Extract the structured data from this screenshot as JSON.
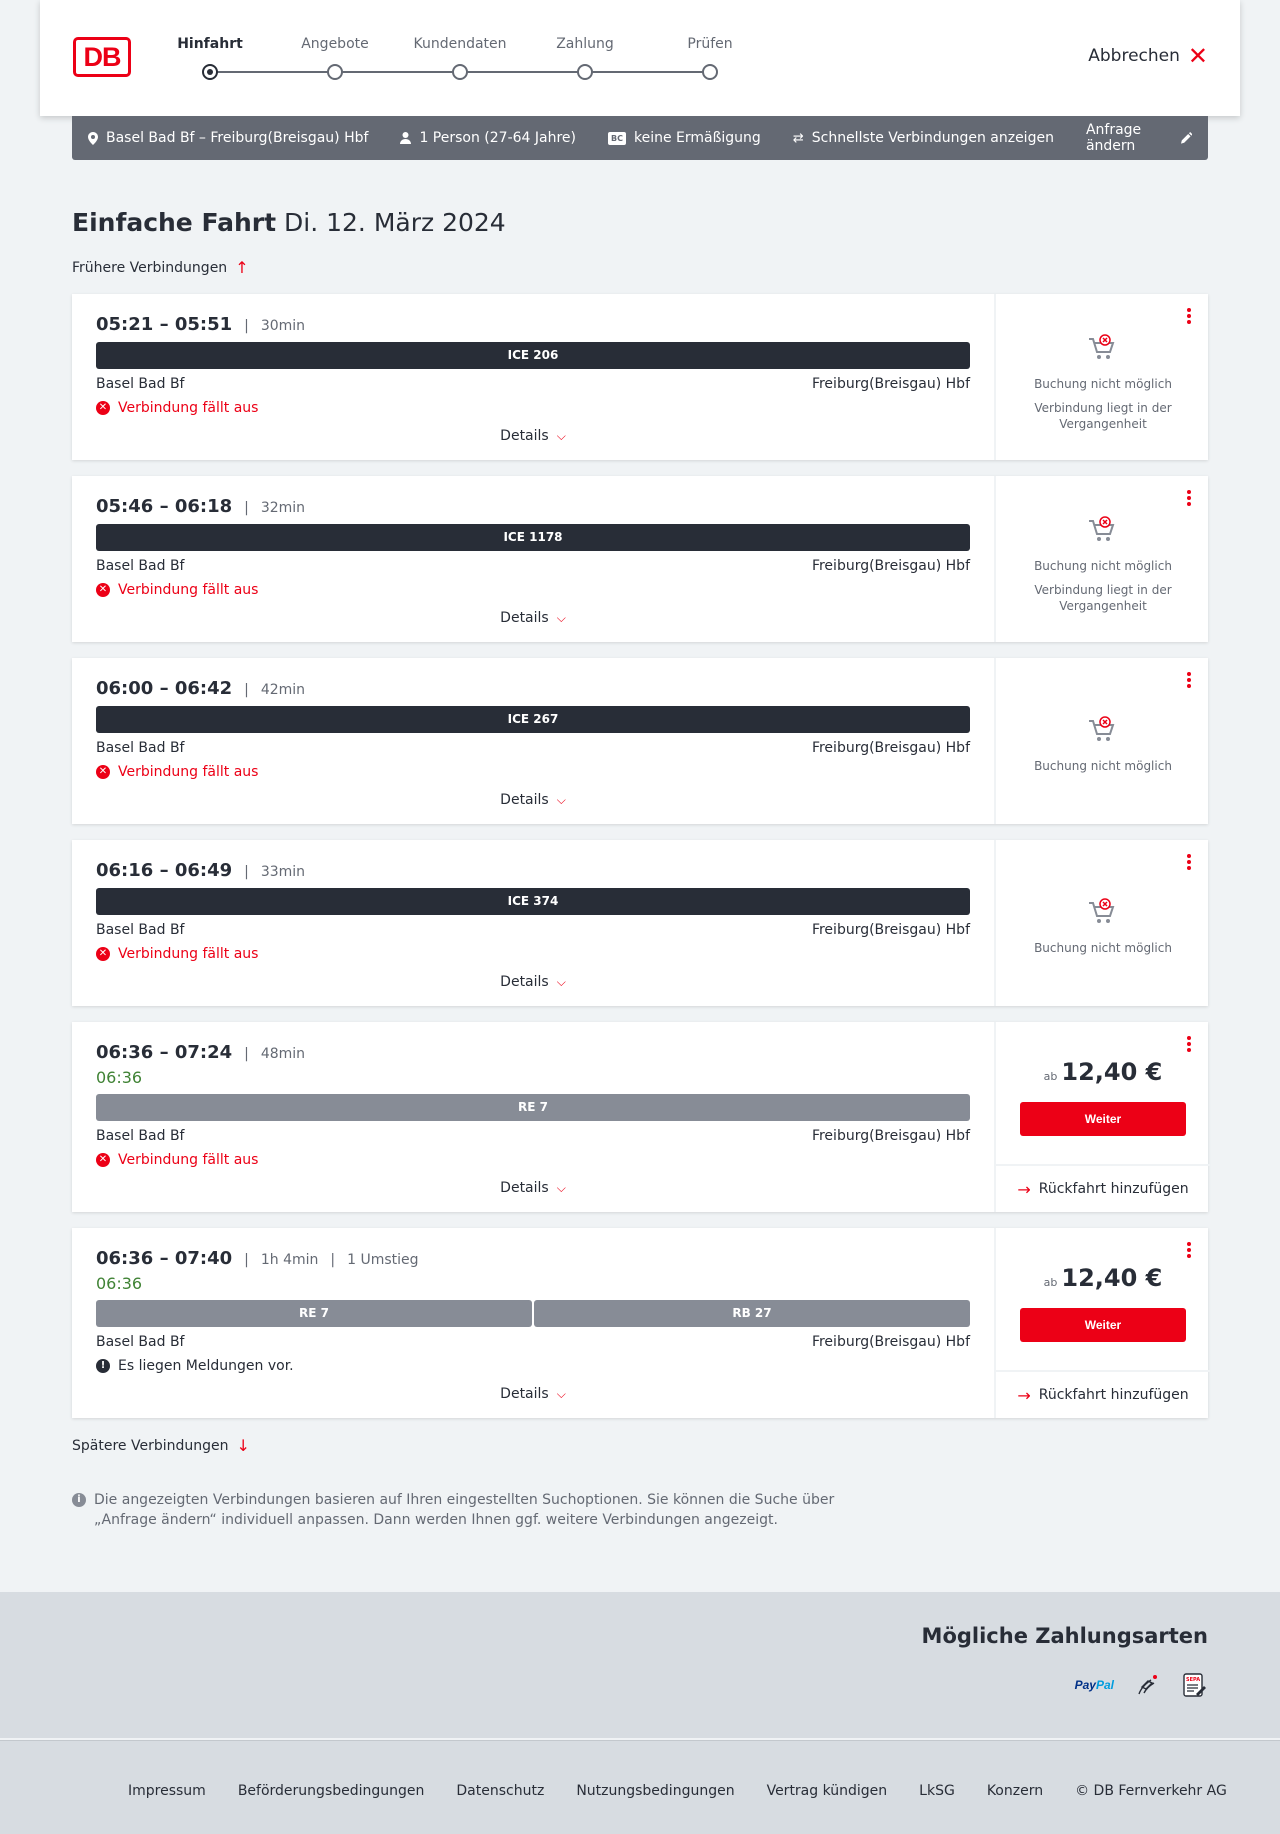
{
  "header": {
    "logo_text": "DB",
    "steps": [
      "Hinfahrt",
      "Angebote",
      "Kundendaten",
      "Zahlung",
      "Prüfen"
    ],
    "active_step": 0,
    "cancel_label": "Abbrechen"
  },
  "search": {
    "route": "Basel Bad Bf – Freiburg(Breisgau) Hbf",
    "passengers": "1 Person (27-64 Jahre)",
    "discount_badge": "BC",
    "discount": "keine Ermäßigung",
    "option": "Schnellste Verbindungen anzeigen",
    "edit_label": "Anfrage ändern"
  },
  "title": {
    "main": "Einfache Fahrt",
    "date": "Di. 12. März 2024"
  },
  "earlier_label": "Frühere Verbindungen",
  "later_label": "Spätere Verbindungen",
  "connections": [
    {
      "times": "05:21 – 05:51",
      "duration": "30min",
      "trains": [
        "ICE 206"
      ],
      "from": "Basel Bad Bf",
      "to": "Freiburg(Breisgau) Hbf",
      "message": "Verbindung fällt aus",
      "details": "Details",
      "status": "Buchung nicht möglich",
      "status_note": "Verbindung liegt in der Vergangenheit"
    },
    {
      "times": "05:46 – 06:18",
      "duration": "32min",
      "trains": [
        "ICE 1178"
      ],
      "from": "Basel Bad Bf",
      "to": "Freiburg(Breisgau) Hbf",
      "message": "Verbindung fällt aus",
      "details": "Details",
      "status": "Buchung nicht möglich",
      "status_note": "Verbindung liegt in der Vergangenheit"
    },
    {
      "times": "06:00 – 06:42",
      "duration": "42min",
      "trains": [
        "ICE 267"
      ],
      "from": "Basel Bad Bf",
      "to": "Freiburg(Breisgau) Hbf",
      "message": "Verbindung fällt aus",
      "details": "Details",
      "status": "Buchung nicht möglich"
    },
    {
      "times": "06:16 – 06:49",
      "duration": "33min",
      "trains": [
        "ICE 374"
      ],
      "from": "Basel Bad Bf",
      "to": "Freiburg(Breisgau) Hbf",
      "message": "Verbindung fällt aus",
      "details": "Details",
      "status": "Buchung nicht möglich"
    },
    {
      "times": "06:36 – 07:24",
      "duration": "48min",
      "realtime": "06:36",
      "trains": [
        "RE 7"
      ],
      "from": "Basel Bad Bf",
      "to": "Freiburg(Breisgau) Hbf",
      "message": "Verbindung fällt aus",
      "details": "Details",
      "price_prefix": "ab",
      "price": "12,40 €",
      "continue_label": "Weiter",
      "return_label": "Rückfahrt hinzufügen"
    },
    {
      "times": "06:36 – 07:40",
      "duration": "1h 4min",
      "transfers": "1 Umstieg",
      "realtime": "06:36",
      "trains": [
        "RE 7",
        "RB 27"
      ],
      "from": "Basel Bad Bf",
      "to": "Freiburg(Breisgau) Hbf",
      "message": "Es liegen Meldungen vor.",
      "details": "Details",
      "price_prefix": "ab",
      "price": "12,40 €",
      "continue_label": "Weiter",
      "return_label": "Rückfahrt hinzufügen"
    }
  ],
  "info_note": "Die angezeigten Verbindungen basieren auf Ihren eingestellten Suchoptionen. Sie können die Suche über „Anfrage ändern“ individuell anpassen. Dann werden Ihnen ggf. weitere Verbindungen angezeigt.",
  "payment": {
    "title": "Mögliche Zahlungsarten",
    "paypal_part1": "Pay",
    "paypal_part2": "Pal",
    "sepa_label": "SEPA"
  },
  "footer_links": [
    "Impressum",
    "Beförderungsbedingungen",
    "Datenschutz",
    "Nutzungsbedingungen",
    "Vertrag kündigen",
    "LkSG",
    "Konzern",
    "© DB Fernverkehr AG"
  ],
  "colors": {
    "accent": "#ec0016",
    "dark": "#282d37",
    "grey": "#646973",
    "realtime": "#408335"
  }
}
